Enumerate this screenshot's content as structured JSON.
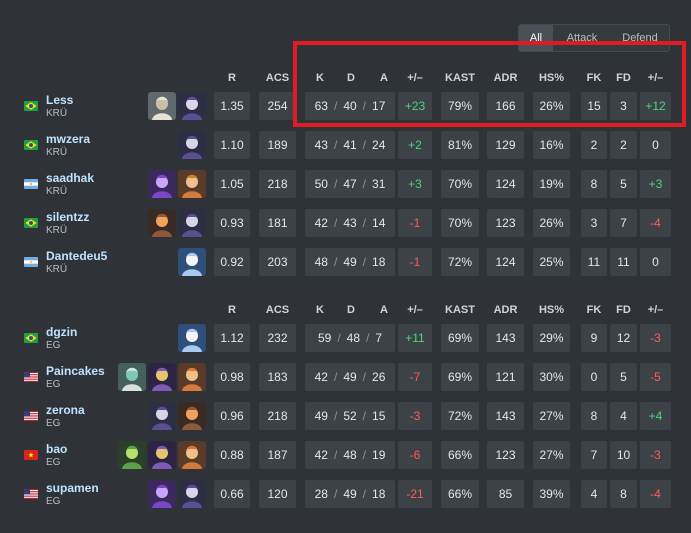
{
  "filter": {
    "options": [
      "All",
      "Attack",
      "Defend"
    ],
    "selected": "All"
  },
  "headers": {
    "r": "R",
    "acs": "ACS",
    "k": "K",
    "d": "D",
    "a": "A",
    "kd_diff": "+/–",
    "kast": "KAST",
    "adr": "ADR",
    "hs": "HS%",
    "fk": "FK",
    "fd": "FD",
    "fk_diff": "+/–"
  },
  "teams": [
    {
      "players": [
        {
          "name": "Less",
          "team": "KRÜ",
          "flag": "brazil",
          "agents": [
            "cypher-agent-icon",
            "omen-agent-icon"
          ],
          "r": "1.35",
          "acs": "254",
          "k": "63",
          "d": "40",
          "a": "17",
          "kd": "+23",
          "kast": "79%",
          "adr": "166",
          "hs": "26%",
          "fk": "15",
          "fd": "3",
          "fkd": "+12"
        },
        {
          "name": "mwzera",
          "team": "KRÜ",
          "flag": "brazil",
          "agents": [
            "omen-agent-icon"
          ],
          "r": "1.10",
          "acs": "189",
          "k": "43",
          "d": "41",
          "a": "24",
          "kd": "+2",
          "kast": "81%",
          "adr": "129",
          "hs": "16%",
          "fk": "2",
          "fd": "2",
          "fkd": "0"
        },
        {
          "name": "saadhak",
          "team": "KRÜ",
          "flag": "argentina",
          "agents": [
            "reyna-agent-icon",
            "breach-agent-icon"
          ],
          "r": "1.05",
          "acs": "218",
          "k": "50",
          "d": "47",
          "a": "31",
          "kd": "+3",
          "kast": "70%",
          "adr": "124",
          "hs": "19%",
          "fk": "8",
          "fd": "5",
          "fkd": "+3"
        },
        {
          "name": "silentzz",
          "team": "KRÜ",
          "flag": "brazil",
          "agents": [
            "phoenix-agent-icon",
            "omen-agent-icon"
          ],
          "r": "0.93",
          "acs": "181",
          "k": "42",
          "d": "43",
          "a": "14",
          "kd": "-1",
          "kast": "70%",
          "adr": "123",
          "hs": "26%",
          "fk": "3",
          "fd": "7",
          "fkd": "-4"
        },
        {
          "name": "Dantedeu5",
          "team": "KRÜ",
          "flag": "argentina",
          "agents": [
            "jett-agent-icon"
          ],
          "r": "0.92",
          "acs": "203",
          "k": "48",
          "d": "49",
          "a": "18",
          "kd": "-1",
          "kast": "72%",
          "adr": "124",
          "hs": "25%",
          "fk": "11",
          "fd": "11",
          "fkd": "0"
        }
      ]
    },
    {
      "players": [
        {
          "name": "dgzin",
          "team": "EG",
          "flag": "brazil",
          "agents": [
            "jett-agent-icon"
          ],
          "r": "1.12",
          "acs": "232",
          "k": "59",
          "d": "48",
          "a": "7",
          "kd": "+11",
          "kast": "69%",
          "adr": "143",
          "hs": "29%",
          "fk": "9",
          "fd": "12",
          "fkd": "-3"
        },
        {
          "name": "Paincakes",
          "team": "EG",
          "flag": "usa",
          "agents": [
            "sage-agent-icon",
            "astra-agent-icon",
            "breach-agent-icon"
          ],
          "r": "0.98",
          "acs": "183",
          "k": "42",
          "d": "49",
          "a": "26",
          "kd": "-7",
          "kast": "69%",
          "adr": "121",
          "hs": "30%",
          "fk": "0",
          "fd": "5",
          "fkd": "-5"
        },
        {
          "name": "zerona",
          "team": "EG",
          "flag": "usa",
          "agents": [
            "omen-agent-icon",
            "phoenix-agent-icon"
          ],
          "r": "0.96",
          "acs": "218",
          "k": "49",
          "d": "52",
          "a": "15",
          "kd": "-3",
          "kast": "72%",
          "adr": "143",
          "hs": "27%",
          "fk": "8",
          "fd": "4",
          "fkd": "+4"
        },
        {
          "name": "bao",
          "team": "EG",
          "flag": "vietnam",
          "agents": [
            "viper-agent-icon",
            "astra-agent-icon",
            "breach-agent-icon"
          ],
          "r": "0.88",
          "acs": "187",
          "k": "42",
          "d": "48",
          "a": "19",
          "kd": "-6",
          "kast": "66%",
          "adr": "123",
          "hs": "27%",
          "fk": "7",
          "fd": "10",
          "fkd": "-3"
        },
        {
          "name": "supamen",
          "team": "EG",
          "flag": "usa",
          "agents": [
            "reyna-agent-icon",
            "omen-agent-icon"
          ],
          "r": "0.66",
          "acs": "120",
          "k": "28",
          "d": "49",
          "a": "18",
          "kd": "-21",
          "kast": "66%",
          "adr": "85",
          "hs": "39%",
          "fk": "4",
          "fd": "8",
          "fkd": "-4"
        }
      ]
    }
  ],
  "colors": {
    "positive": "#4fd27f",
    "negative": "#ff5b5b",
    "highlight_box": "#e01b24",
    "name": "#bfe3ff"
  }
}
